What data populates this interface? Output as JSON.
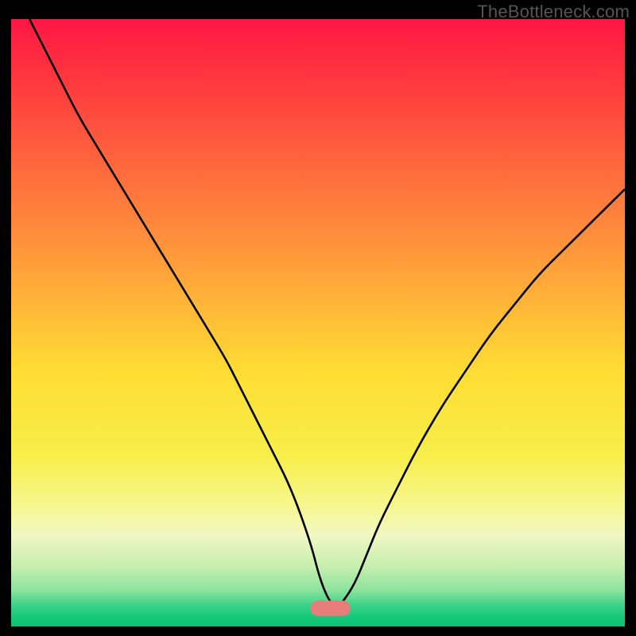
{
  "watermark": "TheBottleneck.com",
  "chart_data": {
    "type": "line",
    "title": "",
    "xlabel": "",
    "ylabel": "",
    "xlim": [
      0,
      100
    ],
    "ylim": [
      0,
      100
    ],
    "grid": false,
    "legend": false,
    "gradient_stops": [
      {
        "offset": 0.0,
        "color": "#ff1744"
      },
      {
        "offset": 0.06,
        "color": "#ff2a3f"
      },
      {
        "offset": 0.38,
        "color": "#ff963b"
      },
      {
        "offset": 0.58,
        "color": "#ffdd33"
      },
      {
        "offset": 0.72,
        "color": "#f7ee4a"
      },
      {
        "offset": 0.8,
        "color": "#f7f78f"
      },
      {
        "offset": 0.85,
        "color": "#f1f7c2"
      },
      {
        "offset": 0.9,
        "color": "#c7efb0"
      },
      {
        "offset": 0.94,
        "color": "#8de39d"
      },
      {
        "offset": 0.965,
        "color": "#3cd389"
      },
      {
        "offset": 0.985,
        "color": "#14c97a"
      },
      {
        "offset": 1.0,
        "color": "#0fbf72"
      }
    ],
    "series": [
      {
        "name": "bottleneck-curve",
        "x": [
          3,
          5,
          8,
          11,
          14,
          17,
          20,
          23,
          26,
          29,
          32,
          35,
          37,
          39,
          41,
          43,
          45,
          47,
          49,
          50,
          51,
          52,
          53,
          54,
          56,
          58,
          60,
          63,
          66,
          70,
          74,
          78,
          82,
          86,
          90,
          94,
          98,
          100
        ],
        "y": [
          100,
          96,
          90,
          84,
          79,
          74,
          69,
          64,
          59,
          54,
          49,
          44,
          40,
          36,
          32,
          28,
          24,
          19,
          13,
          9,
          6,
          4,
          3,
          4,
          7,
          12,
          17,
          23,
          29,
          36,
          42,
          48,
          53,
          58,
          62,
          66,
          70,
          72
        ]
      }
    ],
    "marker": {
      "x": 52,
      "y": 3,
      "width": 6.5,
      "height": 2.5,
      "color": "#e77e7b"
    }
  }
}
